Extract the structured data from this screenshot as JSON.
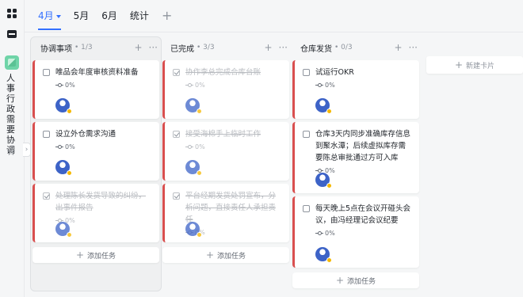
{
  "sidebar": {
    "app_title": "人事行政需要协调",
    "icons": [
      "grid-icon",
      "folder-icon",
      "app-icon",
      "star-icon"
    ],
    "collapse_glyph": "›"
  },
  "tabs": {
    "items": [
      {
        "label": "4月",
        "active": true
      },
      {
        "label": "5月",
        "active": false
      },
      {
        "label": "6月",
        "active": false
      },
      {
        "label": "统计",
        "active": false
      }
    ],
    "add_glyph": "+"
  },
  "colors": {
    "accent": "#3370ff",
    "card_bar": "#d94f4f"
  },
  "board": {
    "add_task_label": "添加任务",
    "new_card_label": "新建卡片",
    "columns": [
      {
        "title": "协调事项",
        "count": "• 1/3",
        "cards": [
          {
            "title": "唯品会年度审核资料准备",
            "progress": "0%",
            "done": false
          },
          {
            "title": "设立外仓需求沟通",
            "progress": "0%",
            "done": false
          },
          {
            "title": "处理陈长发货导致的纠纷，出事件报告",
            "progress": "0%",
            "done": true
          }
        ]
      },
      {
        "title": "已完成",
        "count": "• 3/3",
        "cards": [
          {
            "title": "协作李总完成合库台账",
            "progress": "0%",
            "done": true
          },
          {
            "title": "接受海棉手上临时工作",
            "progress": "0%",
            "done": true
          },
          {
            "title": "平台经期发货处罚宣布，分析问题，直接责任人承担责任",
            "progress": "0%",
            "done": true
          }
        ]
      },
      {
        "title": "仓库发货",
        "count": "• 0/3",
        "cards": [
          {
            "title": "试运行OKR",
            "progress": "0%",
            "done": false
          },
          {
            "title": "仓库3天内同步准确库存信息到聚水潭；后续虚拟库存需要陈总审批通过方可入库",
            "progress": "0%",
            "done": false
          },
          {
            "title": "每天晚上5点在会议开碰头会议，由冯经理记会议纪要",
            "progress": "0%",
            "done": false
          }
        ]
      }
    ]
  }
}
